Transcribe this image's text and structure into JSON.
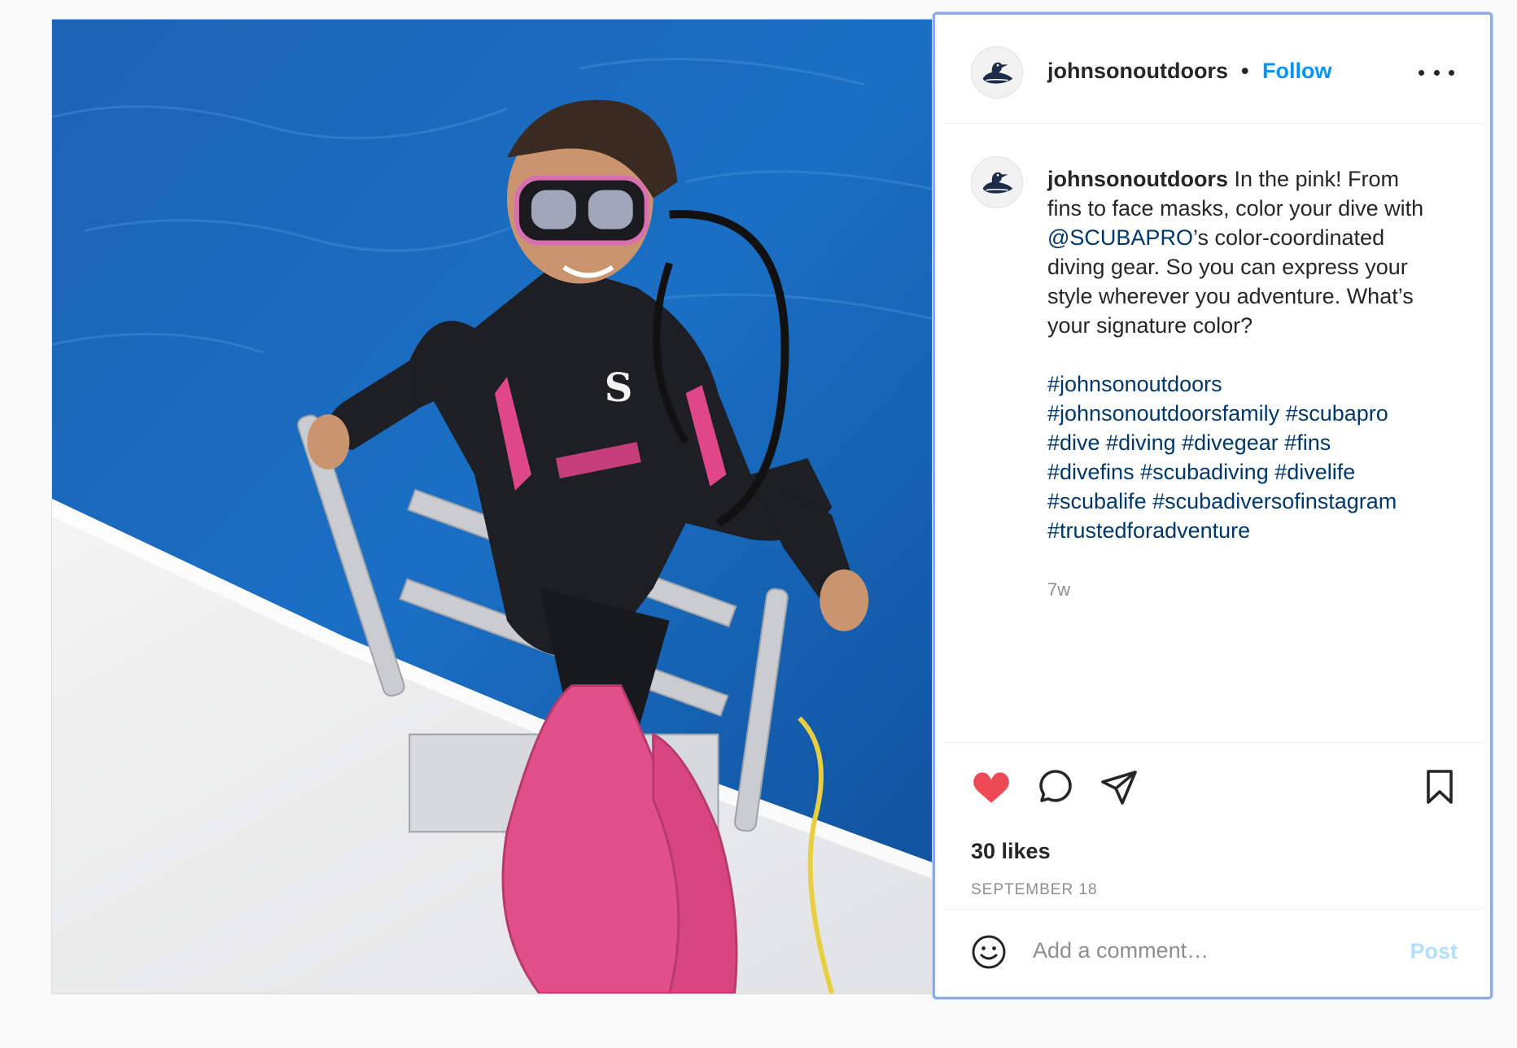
{
  "post": {
    "image_alt": "Scuba diver climbing boat ladder wearing pink fins"
  },
  "header": {
    "username": "johnsonoutdoors",
    "separator": "•",
    "follow_label": "Follow",
    "more_icon": "more-horizontal-icon"
  },
  "caption": {
    "username": "johnsonoutdoors",
    "text_before_mention": " In the pink! From fins to face masks, color your dive with ",
    "mention": "@SCUBAPRO",
    "text_after_mention": "’s color-coordinated diving gear. So you can express your style wherever you adventure. What’s your signature color?",
    "hashtags": [
      "#johnsonoutdoors",
      "#johnsonoutdoorsfamily",
      "#scubapro",
      "#dive",
      "#diving",
      "#divegear",
      "#fins",
      "#divefins",
      "#scubadiving",
      "#divelife",
      "#scubalife",
      "#scubadiversofinstagram",
      "#trustedforadventure"
    ],
    "time_ago": "7w"
  },
  "actions": {
    "heart_icon": "heart-filled-icon",
    "comment_icon": "comment-icon",
    "share_icon": "paper-plane-icon",
    "save_icon": "bookmark-icon",
    "likes_label": "30 likes",
    "date_label": "SEPTEMBER 18",
    "liked": true
  },
  "comment_box": {
    "emoji_icon": "emoji-icon",
    "placeholder": "Add a comment…",
    "post_label": "Post"
  },
  "colors": {
    "follow": "#0095f6",
    "heart": "#ed4956",
    "link": "#00376b",
    "post_disabled": "#b2dffc",
    "panel_focus_border": "#89abe8"
  }
}
